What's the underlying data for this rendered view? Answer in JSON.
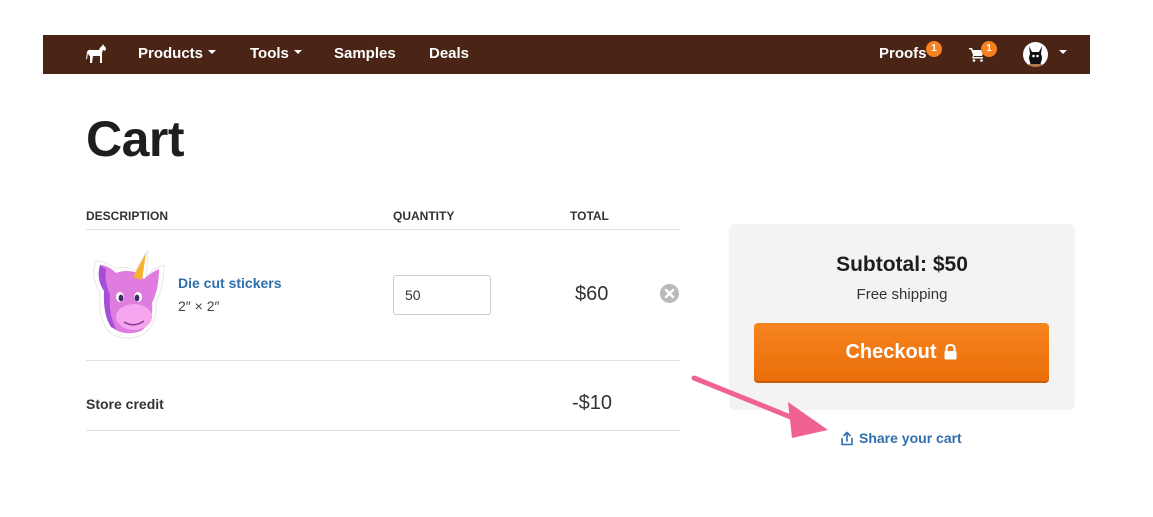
{
  "navbar": {
    "logo_icon": "horse-icon",
    "items": [
      {
        "label": "Products",
        "has_dropdown": true
      },
      {
        "label": "Tools",
        "has_dropdown": true
      },
      {
        "label": "Samples",
        "has_dropdown": false
      },
      {
        "label": "Deals",
        "has_dropdown": false
      }
    ],
    "proofs": {
      "label": "Proofs",
      "badge": "1"
    },
    "cart": {
      "icon": "cart-icon",
      "badge": "1"
    },
    "account": {
      "icon": "avatar-icon",
      "has_dropdown": true
    }
  },
  "page": {
    "title": "Cart"
  },
  "table": {
    "headers": {
      "description": "DESCRIPTION",
      "quantity": "QUANTITY",
      "total": "TOTAL"
    },
    "items": [
      {
        "name": "Die cut stickers",
        "size": "2″ × 2″",
        "quantity": "50",
        "total": "$60",
        "image": "unicorn-sticker-image"
      }
    ],
    "store_credit": {
      "label": "Store credit",
      "value": "-$10"
    }
  },
  "summary": {
    "subtotal": "Subtotal: $50",
    "shipping": "Free shipping",
    "checkout_label": "Checkout",
    "share_label": "Share your cart"
  },
  "colors": {
    "navbar": "#4a2515",
    "badge": "#f7811e",
    "link": "#2f6fad",
    "checkout": "#f7851f",
    "annotation_arrow": "#f06292"
  }
}
